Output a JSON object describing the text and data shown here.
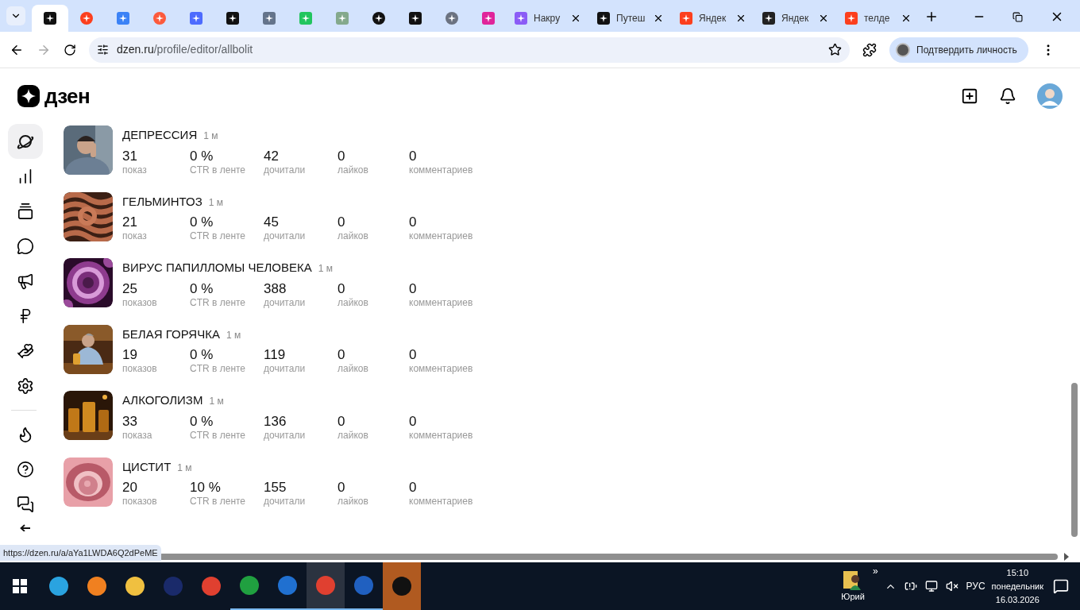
{
  "browser": {
    "tabs": [
      {
        "kind": "icon",
        "selected": true
      },
      {
        "kind": "icon",
        "selected": false
      },
      {
        "kind": "icon",
        "selected": false
      },
      {
        "kind": "icon",
        "selected": false
      },
      {
        "kind": "icon",
        "selected": false
      },
      {
        "kind": "icon",
        "selected": false
      },
      {
        "kind": "icon",
        "selected": false
      },
      {
        "kind": "icon",
        "selected": false
      },
      {
        "kind": "icon",
        "selected": false
      },
      {
        "kind": "icon",
        "selected": false
      },
      {
        "kind": "icon",
        "selected": false
      },
      {
        "kind": "icon",
        "selected": false
      },
      {
        "kind": "icon",
        "selected": false
      },
      {
        "kind": "titled",
        "title": "Накру",
        "selected": false
      },
      {
        "kind": "titled",
        "title": "Путеш",
        "selected": false
      },
      {
        "kind": "titled",
        "title": "Яндек",
        "selected": false
      },
      {
        "kind": "titled",
        "title": "Яндек",
        "selected": false
      },
      {
        "kind": "titled",
        "title": "телде",
        "selected": false
      }
    ],
    "address_host": "dzen.ru",
    "address_path": "/profile/editor/allbolit",
    "profile_button": "Подтвердить личность"
  },
  "header": {
    "logo": "дзен"
  },
  "sidebar": {
    "items": [
      {
        "selected": true
      },
      {
        "selected": false
      },
      {
        "selected": false
      },
      {
        "selected": false
      },
      {
        "selected": false
      },
      {
        "selected": false
      },
      {
        "selected": false
      },
      {
        "selected": false
      },
      {
        "selected": false
      },
      {
        "selected": false
      },
      {
        "selected": false
      },
      {
        "selected": false
      }
    ]
  },
  "articles": [
    {
      "title": "ДЕПРЕССИЯ",
      "age": "1 м",
      "stats": [
        {
          "value": "31",
          "label": "показ"
        },
        {
          "value": "0 %",
          "label": "CTR в ленте"
        },
        {
          "value": "42",
          "label": "дочитали"
        },
        {
          "value": "0",
          "label": "лайков"
        },
        {
          "value": "0",
          "label": "комментариев"
        }
      ]
    },
    {
      "title": "ГЕЛЬМИНТОЗ",
      "age": "1 м",
      "stats": [
        {
          "value": "21",
          "label": "показ"
        },
        {
          "value": "0 %",
          "label": "CTR в ленте"
        },
        {
          "value": "45",
          "label": "дочитали"
        },
        {
          "value": "0",
          "label": "лайков"
        },
        {
          "value": "0",
          "label": "комментариев"
        }
      ]
    },
    {
      "title": "ВИРУС ПАПИЛЛОМЫ ЧЕЛОВЕКА",
      "age": "1 м",
      "stats": [
        {
          "value": "25",
          "label": "показов"
        },
        {
          "value": "0 %",
          "label": "CTR в ленте"
        },
        {
          "value": "388",
          "label": "дочитали"
        },
        {
          "value": "0",
          "label": "лайков"
        },
        {
          "value": "0",
          "label": "комментариев"
        }
      ]
    },
    {
      "title": "БЕЛАЯ ГОРЯЧКА",
      "age": "1 м",
      "stats": [
        {
          "value": "19",
          "label": "показов"
        },
        {
          "value": "0 %",
          "label": "CTR в ленте"
        },
        {
          "value": "119",
          "label": "дочитали"
        },
        {
          "value": "0",
          "label": "лайков"
        },
        {
          "value": "0",
          "label": "комментариев"
        }
      ]
    },
    {
      "title": "АЛКОГОЛИЗМ",
      "age": "1 м",
      "stats": [
        {
          "value": "33",
          "label": "показа"
        },
        {
          "value": "0 %",
          "label": "CTR в ленте"
        },
        {
          "value": "136",
          "label": "дочитали"
        },
        {
          "value": "0",
          "label": "лайков"
        },
        {
          "value": "0",
          "label": "комментариев"
        }
      ]
    },
    {
      "title": "ЦИСТИТ",
      "age": "1 м",
      "stats": [
        {
          "value": "20",
          "label": "показов"
        },
        {
          "value": "10 %",
          "label": "CTR в ленте"
        },
        {
          "value": "155",
          "label": "дочитали"
        },
        {
          "value": "0",
          "label": "лайков"
        },
        {
          "value": "0",
          "label": "комментариев"
        }
      ]
    }
  ],
  "status_url": "https://dzen.ru/a/aYa1LWDA6Q2dPeME",
  "taskbar": {
    "apps": [
      {
        "selected": false
      },
      {
        "selected": false
      },
      {
        "selected": false
      },
      {
        "selected": false
      },
      {
        "selected": false
      },
      {
        "selected": false
      },
      {
        "selected": false
      },
      {
        "selected": true
      },
      {
        "selected": false
      },
      {
        "selected": false
      }
    ],
    "user": "Юрий",
    "overflow": "»",
    "language": "РУС",
    "time": "15:10",
    "weekday": "понедельник",
    "date": "16.03.2026"
  }
}
